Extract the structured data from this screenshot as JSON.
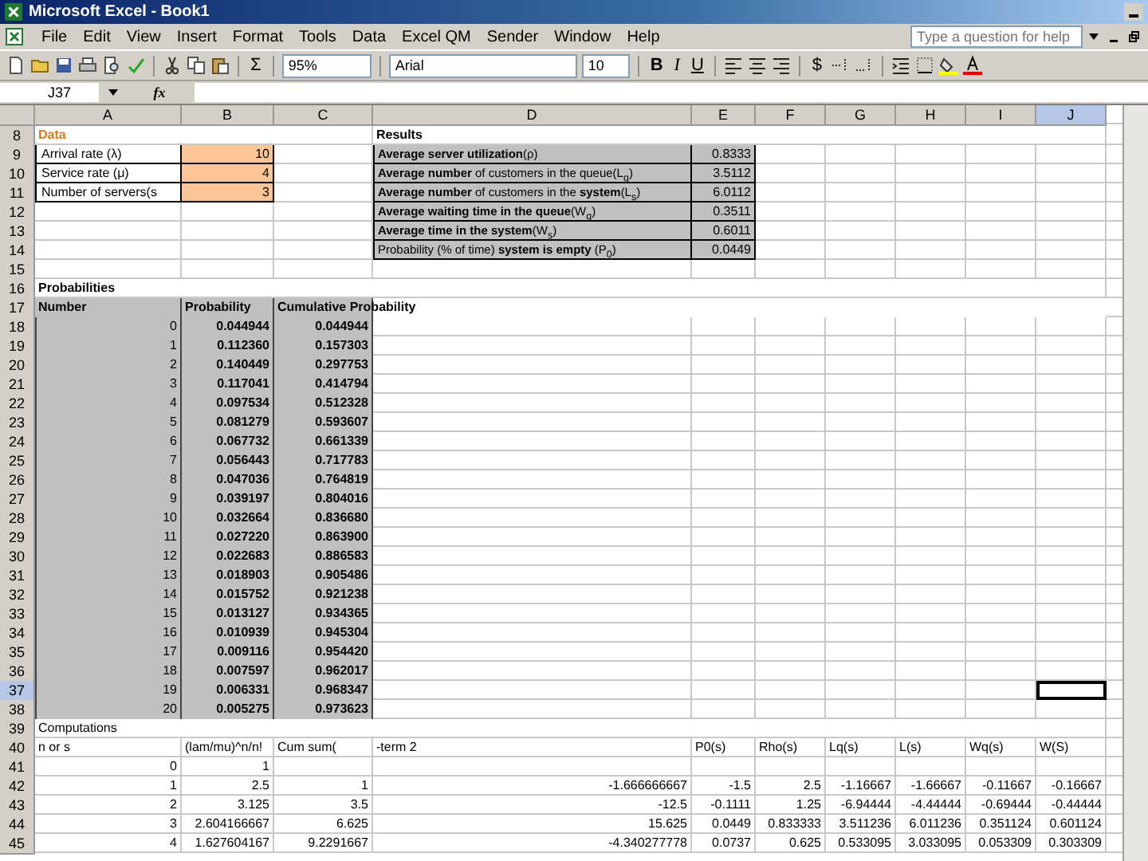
{
  "window": {
    "title": "Microsoft Excel - Book1"
  },
  "menu": {
    "items": [
      "File",
      "Edit",
      "View",
      "Insert",
      "Format",
      "Tools",
      "Data",
      "Excel QM",
      "Sender",
      "Window",
      "Help"
    ],
    "help_placeholder": "Type a question for help"
  },
  "toolbar": {
    "sum": "Σ",
    "zoom": "95%",
    "font": "Arial",
    "size": "10",
    "bold": "B",
    "italic": "I",
    "underline": "U",
    "currency": "$"
  },
  "formula_bar": {
    "name_box": "J37",
    "fx": "fx"
  },
  "sheet": {
    "columns": [
      {
        "label": "A",
        "selected": false
      },
      {
        "label": "B",
        "selected": false
      },
      {
        "label": "C",
        "selected": false
      },
      {
        "label": "D",
        "selected": false
      },
      {
        "label": "E",
        "selected": false
      },
      {
        "label": "F",
        "selected": false
      },
      {
        "label": "G",
        "selected": false
      },
      {
        "label": "H",
        "selected": false
      },
      {
        "label": "I",
        "selected": false
      },
      {
        "label": "J",
        "selected": true
      }
    ],
    "rows": [
      {
        "number": "8",
        "selected": false,
        "cells": {
          "A": {
            "text": "Data",
            "kind": "heading"
          },
          "D": {
            "text": "Results",
            "kind": "bold"
          }
        }
      },
      {
        "number": "9",
        "selected": false,
        "cells": {
          "A": {
            "text": "Arrival rate (λ)",
            "kind": "label-box"
          },
          "B": {
            "text": "10",
            "kind": "input"
          },
          "D": {
            "text": "**Average server utilization**(ρ)",
            "kind": "result-label"
          },
          "E": {
            "text": "0.8333",
            "kind": "result-value"
          }
        }
      },
      {
        "number": "10",
        "selected": false,
        "cells": {
          "A": {
            "text": "Service rate (μ)",
            "kind": "label-box"
          },
          "B": {
            "text": "4",
            "kind": "input"
          },
          "D": {
            "text": "**Average number** of customers in the queue(L$_{q}$)",
            "kind": "result-label"
          },
          "E": {
            "text": "3.5112",
            "kind": "result-value"
          }
        }
      },
      {
        "number": "11",
        "selected": false,
        "cells": {
          "A": {
            "text": "Number of servers(s",
            "kind": "label-box"
          },
          "B": {
            "text": "3",
            "kind": "input"
          },
          "D": {
            "text": "**Average number** of customers in the **system**(L$_{s}$)",
            "kind": "result-label"
          },
          "E": {
            "text": "6.0112",
            "kind": "result-value"
          }
        }
      },
      {
        "number": "12",
        "selected": false,
        "cells": {
          "D": {
            "text": "**Average waiting time in the queue**(W$_{q}$)",
            "kind": "result-label"
          },
          "E": {
            "text": "0.3511",
            "kind": "result-value"
          }
        }
      },
      {
        "number": "13",
        "selected": false,
        "cells": {
          "D": {
            "text": "**Average time in the system**(W$_{s}$)",
            "kind": "result-label"
          },
          "E": {
            "text": "0.6011",
            "kind": "result-value"
          }
        }
      },
      {
        "number": "14",
        "selected": false,
        "cells": {
          "D": {
            "text": "Probability (% of time) **system is empty** (P$_{0}$)",
            "kind": "result-label"
          },
          "E": {
            "text": "0.0449",
            "kind": "result-value"
          }
        }
      },
      {
        "number": "15",
        "selected": false,
        "cells": {}
      },
      {
        "number": "16",
        "selected": false,
        "cells": {
          "A": {
            "text": "Probabilities",
            "kind": "bold"
          }
        }
      },
      {
        "number": "17",
        "selected": false,
        "cells": {
          "A": {
            "text": "Number",
            "kind": "table-head"
          },
          "B": {
            "text": "Probability",
            "kind": "table-head"
          },
          "C": {
            "text": "Cumulative Probability",
            "kind": "table-head"
          }
        }
      },
      {
        "number": "18",
        "selected": false,
        "cells": {
          "A": {
            "text": "0",
            "kind": "table-num"
          },
          "B": {
            "text": "0.044944",
            "kind": "table-bold"
          },
          "C": {
            "text": "0.044944",
            "kind": "table-bold"
          }
        }
      },
      {
        "number": "19",
        "selected": false,
        "cells": {
          "A": {
            "text": "1",
            "kind": "table-num"
          },
          "B": {
            "text": "0.112360",
            "kind": "table-bold"
          },
          "C": {
            "text": "0.157303",
            "kind": "table-bold"
          }
        }
      },
      {
        "number": "20",
        "selected": false,
        "cells": {
          "A": {
            "text": "2",
            "kind": "table-num"
          },
          "B": {
            "text": "0.140449",
            "kind": "table-bold"
          },
          "C": {
            "text": "0.297753",
            "kind": "table-bold"
          }
        }
      },
      {
        "number": "21",
        "selected": false,
        "cells": {
          "A": {
            "text": "3",
            "kind": "table-num"
          },
          "B": {
            "text": "0.117041",
            "kind": "table-bold"
          },
          "C": {
            "text": "0.414794",
            "kind": "table-bold"
          }
        }
      },
      {
        "number": "22",
        "selected": false,
        "cells": {
          "A": {
            "text": "4",
            "kind": "table-num"
          },
          "B": {
            "text": "0.097534",
            "kind": "table-bold"
          },
          "C": {
            "text": "0.512328",
            "kind": "table-bold"
          }
        }
      },
      {
        "number": "23",
        "selected": false,
        "cells": {
          "A": {
            "text": "5",
            "kind": "table-num"
          },
          "B": {
            "text": "0.081279",
            "kind": "table-bold"
          },
          "C": {
            "text": "0.593607",
            "kind": "table-bold"
          }
        }
      },
      {
        "number": "24",
        "selected": false,
        "cells": {
          "A": {
            "text": "6",
            "kind": "table-num"
          },
          "B": {
            "text": "0.067732",
            "kind": "table-bold"
          },
          "C": {
            "text": "0.661339",
            "kind": "table-bold"
          }
        }
      },
      {
        "number": "25",
        "selected": false,
        "cells": {
          "A": {
            "text": "7",
            "kind": "table-num"
          },
          "B": {
            "text": "0.056443",
            "kind": "table-bold"
          },
          "C": {
            "text": "0.717783",
            "kind": "table-bold"
          }
        }
      },
      {
        "number": "26",
        "selected": false,
        "cells": {
          "A": {
            "text": "8",
            "kind": "table-num"
          },
          "B": {
            "text": "0.047036",
            "kind": "table-bold"
          },
          "C": {
            "text": "0.764819",
            "kind": "table-bold"
          }
        }
      },
      {
        "number": "27",
        "selected": false,
        "cells": {
          "A": {
            "text": "9",
            "kind": "table-num"
          },
          "B": {
            "text": "0.039197",
            "kind": "table-bold"
          },
          "C": {
            "text": "0.804016",
            "kind": "table-bold"
          }
        }
      },
      {
        "number": "28",
        "selected": false,
        "cells": {
          "A": {
            "text": "10",
            "kind": "table-num"
          },
          "B": {
            "text": "0.032664",
            "kind": "table-bold"
          },
          "C": {
            "text": "0.836680",
            "kind": "table-bold"
          }
        }
      },
      {
        "number": "29",
        "selected": false,
        "cells": {
          "A": {
            "text": "11",
            "kind": "table-num"
          },
          "B": {
            "text": "0.027220",
            "kind": "table-bold"
          },
          "C": {
            "text": "0.863900",
            "kind": "table-bold"
          }
        }
      },
      {
        "number": "30",
        "selected": false,
        "cells": {
          "A": {
            "text": "12",
            "kind": "table-num"
          },
          "B": {
            "text": "0.022683",
            "kind": "table-bold"
          },
          "C": {
            "text": "0.886583",
            "kind": "table-bold"
          }
        }
      },
      {
        "number": "31",
        "selected": false,
        "cells": {
          "A": {
            "text": "13",
            "kind": "table-num"
          },
          "B": {
            "text": "0.018903",
            "kind": "table-bold"
          },
          "C": {
            "text": "0.905486",
            "kind": "table-bold"
          }
        }
      },
      {
        "number": "32",
        "selected": false,
        "cells": {
          "A": {
            "text": "14",
            "kind": "table-num"
          },
          "B": {
            "text": "0.015752",
            "kind": "table-bold"
          },
          "C": {
            "text": "0.921238",
            "kind": "table-bold"
          }
        }
      },
      {
        "number": "33",
        "selected": false,
        "cells": {
          "A": {
            "text": "15",
            "kind": "table-num"
          },
          "B": {
            "text": "0.013127",
            "kind": "table-bold"
          },
          "C": {
            "text": "0.934365",
            "kind": "table-bold"
          }
        }
      },
      {
        "number": "34",
        "selected": false,
        "cells": {
          "A": {
            "text": "16",
            "kind": "table-num"
          },
          "B": {
            "text": "0.010939",
            "kind": "table-bold"
          },
          "C": {
            "text": "0.945304",
            "kind": "table-bold"
          }
        }
      },
      {
        "number": "35",
        "selected": false,
        "cells": {
          "A": {
            "text": "17",
            "kind": "table-num"
          },
          "B": {
            "text": "0.009116",
            "kind": "table-bold"
          },
          "C": {
            "text": "0.954420",
            "kind": "table-bold"
          }
        }
      },
      {
        "number": "36",
        "selected": false,
        "cells": {
          "A": {
            "text": "18",
            "kind": "table-num"
          },
          "B": {
            "text": "0.007597",
            "kind": "table-bold"
          },
          "C": {
            "text": "0.962017",
            "kind": "table-bold"
          }
        }
      },
      {
        "number": "37",
        "selected": true,
        "cells": {
          "A": {
            "text": "19",
            "kind": "table-num"
          },
          "B": {
            "text": "0.006331",
            "kind": "table-bold"
          },
          "C": {
            "text": "0.968347",
            "kind": "table-bold"
          }
        }
      },
      {
        "number": "38",
        "selected": false,
        "cells": {
          "A": {
            "text": "20",
            "kind": "table-num"
          },
          "B": {
            "text": "0.005275",
            "kind": "table-bold"
          },
          "C": {
            "text": "0.973623",
            "kind": "table-bold"
          }
        }
      },
      {
        "number": "39",
        "selected": false,
        "cells": {
          "A": {
            "text": "Computations",
            "kind": "text"
          }
        }
      },
      {
        "number": "40",
        "selected": false,
        "cells": {
          "A": {
            "text": "n or s",
            "kind": "text"
          },
          "B": {
            "text": "(lam/mu)^n/n!",
            "kind": "text"
          },
          "C": {
            "text": "Cum sum(",
            "kind": "text"
          },
          "D": {
            "text": "-term 2",
            "kind": "text"
          },
          "E": {
            "text": "P0(s)",
            "kind": "text"
          },
          "F": {
            "text": "Rho(s)",
            "kind": "text"
          },
          "G": {
            "text": "Lq(s)",
            "kind": "text"
          },
          "H": {
            "text": "L(s)",
            "kind": "text"
          },
          "I": {
            "text": "Wq(s)",
            "kind": "text"
          },
          "J": {
            "text": "W(S)",
            "kind": "text"
          }
        }
      },
      {
        "number": "41",
        "selected": false,
        "cells": {
          "A": {
            "text": "0",
            "kind": "number"
          },
          "B": {
            "text": "1",
            "kind": "number"
          }
        }
      },
      {
        "number": "42",
        "selected": false,
        "cells": {
          "A": {
            "text": "1",
            "kind": "number"
          },
          "B": {
            "text": "2.5",
            "kind": "number"
          },
          "C": {
            "text": "1",
            "kind": "number"
          },
          "D": {
            "text": "-1.666666667",
            "kind": "number"
          },
          "E": {
            "text": "-1.5",
            "kind": "number"
          },
          "F": {
            "text": "2.5",
            "kind": "number"
          },
          "G": {
            "text": "-1.16667",
            "kind": "number"
          },
          "H": {
            "text": "-1.66667",
            "kind": "number"
          },
          "I": {
            "text": "-0.11667",
            "kind": "number"
          },
          "J": {
            "text": "-0.16667",
            "kind": "number"
          }
        }
      },
      {
        "number": "43",
        "selected": false,
        "cells": {
          "A": {
            "text": "2",
            "kind": "number"
          },
          "B": {
            "text": "3.125",
            "kind": "number"
          },
          "C": {
            "text": "3.5",
            "kind": "number"
          },
          "D": {
            "text": "-12.5",
            "kind": "number"
          },
          "E": {
            "text": "-0.1111",
            "kind": "number"
          },
          "F": {
            "text": "1.25",
            "kind": "number"
          },
          "G": {
            "text": "-6.94444",
            "kind": "number"
          },
          "H": {
            "text": "-4.44444",
            "kind": "number"
          },
          "I": {
            "text": "-0.69444",
            "kind": "number"
          },
          "J": {
            "text": "-0.44444",
            "kind": "number"
          }
        }
      },
      {
        "number": "44",
        "selected": false,
        "cells": {
          "A": {
            "text": "3",
            "kind": "number"
          },
          "B": {
            "text": "2.604166667",
            "kind": "number"
          },
          "C": {
            "text": "6.625",
            "kind": "number"
          },
          "D": {
            "text": "15.625",
            "kind": "number"
          },
          "E": {
            "text": "0.0449",
            "kind": "number"
          },
          "F": {
            "text": "0.833333",
            "kind": "number"
          },
          "G": {
            "text": "3.511236",
            "kind": "number"
          },
          "H": {
            "text": "6.011236",
            "kind": "number"
          },
          "I": {
            "text": "0.351124",
            "kind": "number"
          },
          "J": {
            "text": "0.601124",
            "kind": "number"
          }
        }
      },
      {
        "number": "45",
        "selected": false,
        "cells": {
          "A": {
            "text": "4",
            "kind": "number"
          },
          "B": {
            "text": "1.627604167",
            "kind": "number"
          },
          "C": {
            "text": "9.2291667",
            "kind": "number"
          },
          "D": {
            "text": "-4.340277778",
            "kind": "number"
          },
          "E": {
            "text": "0.0737",
            "kind": "number"
          },
          "F": {
            "text": "0.625",
            "kind": "number"
          },
          "G": {
            "text": "0.533095",
            "kind": "number"
          },
          "H": {
            "text": "3.033095",
            "kind": "number"
          },
          "I": {
            "text": "0.053309",
            "kind": "number"
          },
          "J": {
            "text": "0.303309",
            "kind": "number"
          }
        }
      }
    ]
  }
}
